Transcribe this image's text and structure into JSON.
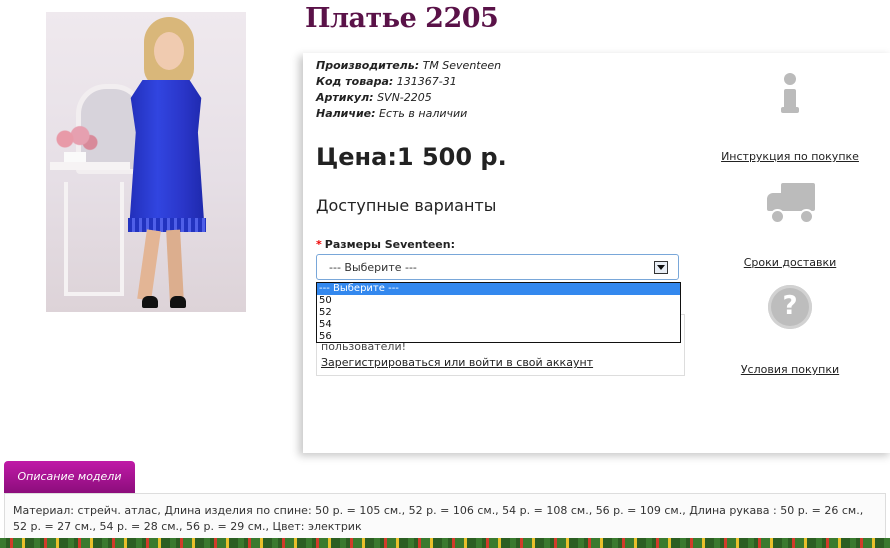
{
  "product": {
    "title": "Платье 2205",
    "meta": [
      {
        "label": "Производитель:",
        "value": "ТМ Seventeen"
      },
      {
        "label": "Код товара:",
        "value": "131367-31"
      },
      {
        "label": "Артикул:",
        "value": "SVN-2205"
      },
      {
        "label": "Наличие:",
        "value": "Есть в наличии"
      }
    ],
    "price": "Цена:1 500 р.",
    "variants_heading": "Доступные варианты"
  },
  "size": {
    "required_mark": "*",
    "label": "Размеры Seventeen:",
    "selected": "--- Выберите ---",
    "options": [
      "--- Выберите ---",
      "50",
      "52",
      "54",
      "56"
    ]
  },
  "login_notice": {
    "text": "пользователи!",
    "link": "Зарегистрироваться или войти в свой аккаунт"
  },
  "side_links": {
    "instruction": "Инструкция по покупке",
    "delivery": "Сроки доставки",
    "conditions": "Условия покупки"
  },
  "description": {
    "tab": "Описание модели",
    "text": "Материал: стрейч. атлас, Длина изделия по спине: 50 р. = 105 см., 52 р. = 106 см., 54 р. = 108 см., 56 р. = 109 см., Длина рукава : 50 р. = 26 см., 52 р. = 27 см., 54 р. = 28 см., 56 р. = 29 см., Цвет: электрик"
  },
  "colors": {
    "title": "#5a1248",
    "tab": "#a3118f",
    "dropdown_highlight": "#3388ee",
    "required": "#ee0000"
  },
  "icons": {
    "instruction": "info-icon",
    "delivery": "truck-icon",
    "conditions": "question-icon",
    "select_arrow": "chevron-down-icon"
  }
}
